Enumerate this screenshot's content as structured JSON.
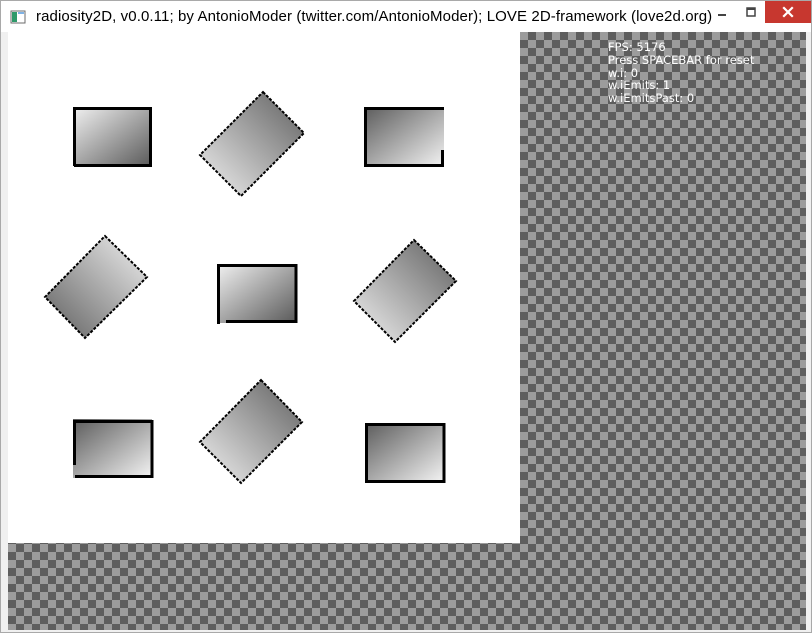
{
  "window": {
    "title": "radiosity2D, v0.0.11; by AntonioModer (twitter.com/AntonioModer); LOVE 2D-framework (love2d.org)"
  },
  "hud": {
    "fps": "FPS: 5176",
    "reset_hint": "Press SPACEBAR for reset",
    "wi": "w.i: 0",
    "iemits": "w.iEmits: 1",
    "iemits_past": "w.iEmitsPast: 0"
  },
  "colors": {
    "close_button": "#c7372f",
    "checker_light": "#9c9c9c",
    "checker_dark": "#5e5e5e"
  },
  "icons": {
    "app": "love-app-icon",
    "minimize": "minimize-icon",
    "maximize": "maximize-icon",
    "close": "close-icon"
  }
}
